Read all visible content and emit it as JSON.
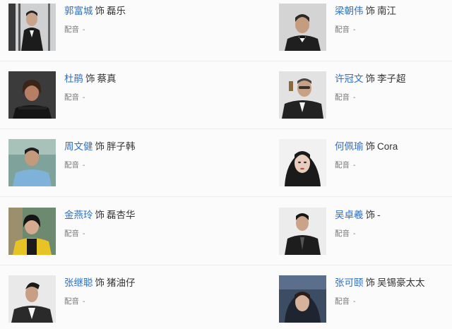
{
  "cast": [
    {
      "actor": "郭富城",
      "shi": "饰",
      "role": "磊乐",
      "voice_label": "配音",
      "voice_value": "-"
    },
    {
      "actor": "梁朝伟",
      "shi": "饰",
      "role": "南江",
      "voice_label": "配音",
      "voice_value": "-"
    },
    {
      "actor": "杜鹃",
      "shi": "饰",
      "role": "蔡真",
      "voice_label": "配音",
      "voice_value": "-"
    },
    {
      "actor": "许冠文",
      "shi": "饰",
      "role": "李子超",
      "voice_label": "配音",
      "voice_value": "-"
    },
    {
      "actor": "周文健",
      "shi": "饰",
      "role": "胖子韩",
      "voice_label": "配音",
      "voice_value": "-"
    },
    {
      "actor": "何佩瑜",
      "shi": "饰",
      "role": "Cora",
      "voice_label": "配音",
      "voice_value": "-"
    },
    {
      "actor": "金燕玲",
      "shi": "饰",
      "role": "磊杏华",
      "voice_label": "配音",
      "voice_value": "-"
    },
    {
      "actor": "吴卓羲",
      "shi": "饰",
      "role": "-",
      "voice_label": "配音",
      "voice_value": "-"
    },
    {
      "actor": "张继聪",
      "shi": "饰",
      "role": "猪油仔",
      "voice_label": "配音",
      "voice_value": "-"
    },
    {
      "actor": "张可颐",
      "shi": "饰",
      "role": "吴锡豪太太",
      "voice_label": "配音",
      "voice_value": "-"
    }
  ],
  "colors": {
    "actor_link": "#2f6fc1",
    "text": "#333333",
    "muted": "#777777",
    "divider": "#ececec"
  }
}
